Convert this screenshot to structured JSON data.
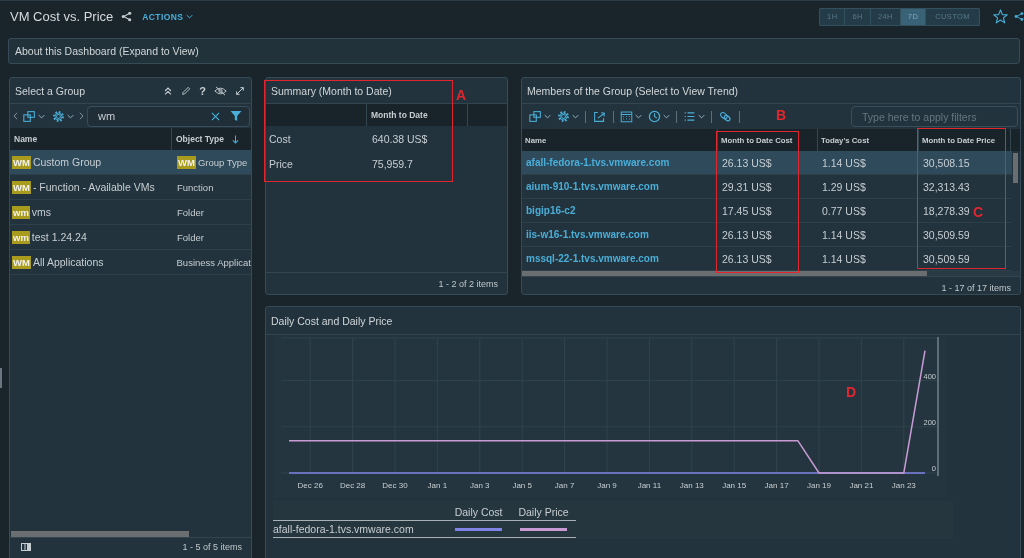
{
  "header": {
    "title": "VM Cost vs. Price",
    "actions": "ACTIONS",
    "time_ranges": [
      {
        "label": "1H",
        "selected": false
      },
      {
        "label": "6H",
        "selected": false
      },
      {
        "label": "24H",
        "selected": false
      },
      {
        "label": "7D",
        "selected": true
      },
      {
        "label": "CUSTOM",
        "selected": false
      }
    ]
  },
  "about": {
    "title": "About this Dashboard (Expand to View)"
  },
  "group_panel": {
    "title": "Select a Group",
    "help": "?",
    "search": {
      "value": "wm"
    },
    "columns": [
      {
        "label": "Name",
        "sorted": false
      },
      {
        "label": "Object Type",
        "sorted": true
      }
    ],
    "rows": [
      {
        "selected": true,
        "name": {
          "match": "WM",
          "text": "Custom Group"
        },
        "type": {
          "match": "WM",
          "text": "Group Type"
        }
      },
      {
        "selected": false,
        "name": {
          "match": "WM",
          "text": "- Function - Available VMs"
        },
        "type": {
          "text": "Function"
        }
      },
      {
        "selected": false,
        "name": {
          "match": "wm",
          "text": "vms"
        },
        "type": {
          "text": "Folder"
        }
      },
      {
        "selected": false,
        "name": {
          "match": "wm",
          "text": "test 1.24.24"
        },
        "type": {
          "text": "Folder"
        }
      },
      {
        "selected": false,
        "name": {
          "match": "WM",
          "text": "All Applications"
        },
        "type": {
          "text": "Business Applicat"
        }
      }
    ],
    "footer": "1 - 5 of 5 items"
  },
  "summary": {
    "title": "Summary (Month to Date)",
    "column": "Month to Date",
    "rows": [
      {
        "label": "Cost",
        "value": "640.38 US$"
      },
      {
        "label": "Price",
        "value": "75,959.7"
      }
    ],
    "footer": "1 - 2 of 2 items"
  },
  "members": {
    "title": "Members of the Group (Select to View Trend)",
    "filter": {
      "placeholder": "Type here to apply filters"
    },
    "columns": [
      "Name",
      "Month to Date Cost",
      "Today's Cost",
      "Month to Date Price"
    ],
    "rows": [
      {
        "selected": true,
        "name": "afall-fedora-1.tvs.vmware.com",
        "mtd_cost": "26.13 US$",
        "today_cost": "1.14 US$",
        "mtd_price": "30,508.15"
      },
      {
        "selected": false,
        "name": "aium-910-1.tvs.vmware.com",
        "mtd_cost": "29.31 US$",
        "today_cost": "1.29 US$",
        "mtd_price": "32,313.43"
      },
      {
        "selected": false,
        "name": "bigip16-c2",
        "mtd_cost": "17.45 US$",
        "today_cost": "0.77 US$",
        "mtd_price": "18,278.39"
      },
      {
        "selected": false,
        "name": "iis-w16-1.tvs.vmware.com",
        "mtd_cost": "26.13 US$",
        "today_cost": "1.14 US$",
        "mtd_price": "30,509.59"
      },
      {
        "selected": false,
        "name": "mssql-22-1.tvs.vmware.com",
        "mtd_cost": "26.13 US$",
        "today_cost": "1.14 US$",
        "mtd_price": "30,509.59"
      }
    ],
    "footer": "1 - 17 of 17 items"
  },
  "chart": {
    "title": "Daily Cost and Daily Price",
    "chart_data": {
      "type": "line",
      "grid": true,
      "categories": [
        null,
        "Dec 26",
        null,
        "Dec 28",
        null,
        "Dec 30",
        null,
        "Jan 1",
        null,
        "Jan 3",
        null,
        "Jan 5",
        null,
        "Jan 7",
        null,
        "Jan 9",
        null,
        "Jan 11",
        null,
        "Jan 13",
        null,
        "Jan 15",
        null,
        "Jan 17",
        null,
        "Jan 19",
        null,
        "Jan 21",
        null,
        "Jan 23",
        null
      ],
      "series": [
        {
          "name": "Daily Cost",
          "color": "#7f83e6",
          "values": [
            0,
            0,
            0,
            0,
            0,
            0,
            0,
            0,
            0,
            0,
            0,
            0,
            0,
            0,
            0,
            0,
            0,
            0,
            0,
            0,
            0,
            0,
            0,
            0,
            0,
            0,
            0,
            0,
            0,
            0,
            0
          ]
        },
        {
          "name": "Daily Price",
          "color": "#c99bd4",
          "values": [
            140,
            140,
            140,
            140,
            140,
            140,
            140,
            140,
            140,
            140,
            140,
            140,
            140,
            140,
            140,
            140,
            140,
            140,
            140,
            140,
            140,
            140,
            140,
            140,
            140,
            0,
            0,
            0,
            0,
            0,
            530
          ]
        }
      ],
      "ylim": [
        0,
        580
      ],
      "yticks": [
        0,
        200,
        400
      ]
    },
    "legend": {
      "entity": "afall-fedora-1.tvs.vmware.com"
    }
  },
  "annotations": [
    {
      "label": "A",
      "boxed": true
    },
    {
      "label": "B",
      "boxed": true
    },
    {
      "label": "C",
      "boxed": true
    },
    {
      "label": "D",
      "boxed": false
    }
  ]
}
